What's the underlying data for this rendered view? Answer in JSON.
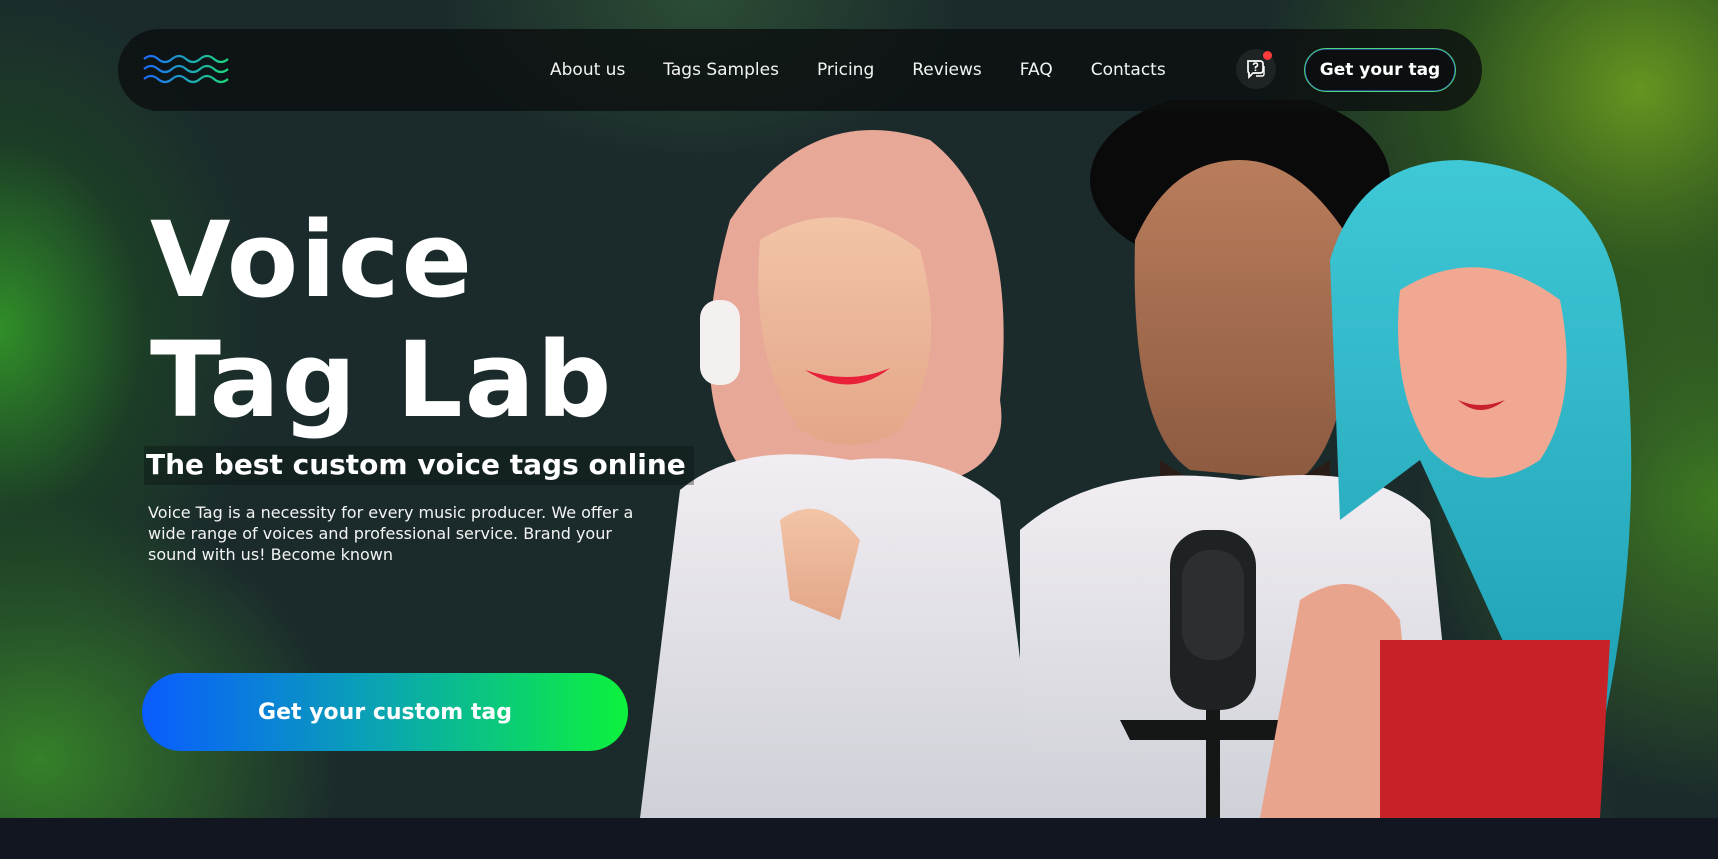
{
  "nav": {
    "links": [
      {
        "label": "About us"
      },
      {
        "label": "Tags Samples"
      },
      {
        "label": "Pricing"
      },
      {
        "label": "Reviews"
      },
      {
        "label": "FAQ"
      },
      {
        "label": "Contacts"
      }
    ],
    "support_icon": "chat-question-icon",
    "notification": true,
    "cta_label": "Get your tag"
  },
  "hero": {
    "title_line1": "Voice",
    "title_line2": "Tag Lab",
    "subtitle": "The best custom voice tags online",
    "description": "Voice Tag is a necessity for every music producer. We offer a wide range of voices and professional service. Brand your sound with us! Become known",
    "cta_label": "Get your custom tag"
  },
  "colors": {
    "accent_blue": "#0a5cff",
    "accent_green": "#0cf23c",
    "notification_red": "#ff3b3b",
    "bottom_bar": "#121621"
  }
}
